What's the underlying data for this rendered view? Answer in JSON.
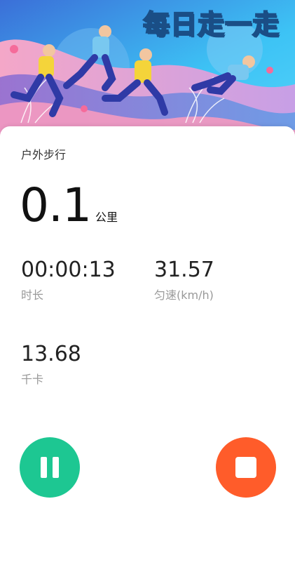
{
  "banner": {
    "title": "每日走一走",
    "colors": {
      "sky": "#3dc3f5",
      "wave_pink": "#f29ac1",
      "wave_purple": "#9b7fd6",
      "runner_shirt_yellow": "#f4d43a",
      "runner_shirt_blue": "#79c8f0",
      "runner_pants": "#2f3aa6"
    }
  },
  "workout": {
    "mode_label": "户外步行",
    "distance": {
      "value": "0.1",
      "unit": "公里"
    },
    "stats": {
      "duration": {
        "value": "00:00:13",
        "label": "时长"
      },
      "pace": {
        "value": "31.57",
        "label": "匀速(km/h)"
      },
      "calories": {
        "value": "13.68",
        "label": "千卡"
      }
    }
  },
  "controls": {
    "pause_color": "#1dc792",
    "stop_color": "#ff5c2a",
    "pause_icon": "pause-icon",
    "stop_icon": "stop-icon"
  }
}
